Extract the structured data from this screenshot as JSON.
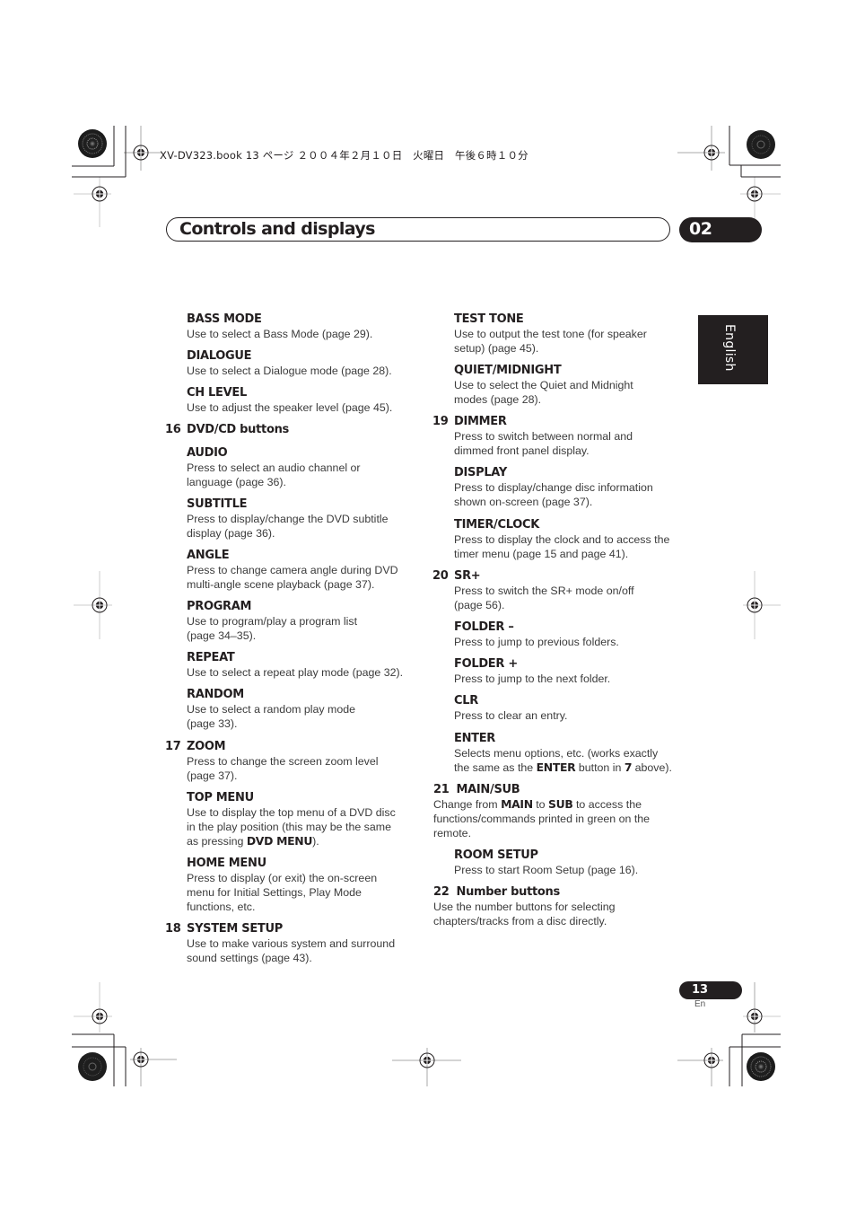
{
  "print_info": "XV-DV323.book  13 ページ  ２００４年２月１０日　火曜日　午後６時１０分",
  "header": {
    "title": "Controls and displays",
    "chapter": "02"
  },
  "language_tab": "English",
  "left_column": [
    {
      "num": "",
      "title": "BASS MODE",
      "desc": [
        "Use to select a Bass Mode (page 29)."
      ]
    },
    {
      "num": "",
      "title": "DIALOGUE",
      "desc": [
        "Use to select a Dialogue mode (page 28)."
      ]
    },
    {
      "num": "",
      "title": "CH LEVEL",
      "desc": [
        "Use to adjust the speaker level (page 45)."
      ]
    },
    {
      "num": "16",
      "title": "DVD/CD buttons",
      "desc": []
    },
    {
      "num": "",
      "title": "AUDIO",
      "desc": [
        "Press to select an audio channel or",
        "language (page 36)."
      ]
    },
    {
      "num": "",
      "title": "SUBTITLE",
      "desc": [
        "Press to display/change the DVD subtitle",
        "display (page 36)."
      ]
    },
    {
      "num": "",
      "title": "ANGLE",
      "desc": [
        "Press to change camera angle during DVD",
        "multi-angle scene playback (page 37)."
      ]
    },
    {
      "num": "",
      "title": "PROGRAM",
      "desc": [
        "Use to program/play a program list",
        "(page 34–35)."
      ]
    },
    {
      "num": "",
      "title": "REPEAT",
      "desc": [
        "Use to select a repeat play mode (page 32)."
      ]
    },
    {
      "num": "",
      "title": "RANDOM",
      "desc": [
        "Use to select a random play mode",
        "(page 33)."
      ]
    },
    {
      "num": "17",
      "title": "ZOOM",
      "desc": [
        "Press to change the screen zoom level",
        "(page 37)."
      ]
    },
    {
      "num": "",
      "title": "TOP MENU",
      "desc": [
        "Use to display the top menu of a DVD disc",
        "in the play position (this may be the same"
      ],
      "desc_tail": {
        "pre": "as pressing ",
        "bold": "DVD MENU",
        "post": ")."
      }
    },
    {
      "num": "",
      "title": "HOME MENU",
      "desc": [
        "Press to display (or exit) the on-screen",
        "menu for Initial Settings, Play Mode",
        "functions, etc."
      ]
    },
    {
      "num": "18",
      "title": "SYSTEM SETUP",
      "desc": [
        "Use to make various system and surround",
        "sound settings (page 43)."
      ]
    }
  ],
  "right_column": [
    {
      "num": "",
      "title": "TEST TONE",
      "desc": [
        "Use to output the test tone (for speaker",
        "setup) (page 45)."
      ]
    },
    {
      "num": "",
      "title": "QUIET/MIDNIGHT",
      "desc": [
        "Use to select the Quiet and Midnight",
        "modes (page 28)."
      ]
    },
    {
      "num": "19",
      "title": "DIMMER",
      "desc": [
        "Press to switch between normal and",
        "dimmed front panel display."
      ]
    },
    {
      "num": "",
      "title": "DISPLAY",
      "desc": [
        "Press to display/change disc information",
        "shown on-screen (page 37)."
      ]
    },
    {
      "num": "",
      "title": "TIMER/CLOCK",
      "desc": [
        "Press to display the clock and to access the",
        "timer menu (page 15 and page 41)."
      ]
    },
    {
      "num": "20",
      "title": "SR+",
      "desc": [
        "Press to switch the SR+ mode on/off",
        "(page 56)."
      ]
    },
    {
      "num": "",
      "title": "FOLDER –",
      "desc": [
        "Press to jump to previous folders."
      ]
    },
    {
      "num": "",
      "title": "FOLDER +",
      "desc": [
        "Press to jump to the next folder."
      ]
    },
    {
      "num": "",
      "title": "CLR",
      "desc": [
        "Press to clear an entry."
      ]
    },
    {
      "num": "",
      "title": "ENTER",
      "desc": [
        "Selects menu options, etc. (works exactly"
      ],
      "desc_tail": {
        "pre": "the same as the ",
        "bold": "ENTER",
        "mid": " button in ",
        "bold2": "7",
        "post": " above)."
      }
    },
    {
      "num": "21",
      "title": "MAIN/SUB",
      "outdent": true,
      "desc_rich": [
        {
          "pre": "Change from ",
          "bold": "MAIN",
          "mid": " to ",
          "bold2": "SUB",
          "post": " to access the"
        }
      ],
      "desc": [
        "functions/commands printed in green on the",
        "remote."
      ]
    },
    {
      "num": "",
      "title": "ROOM SETUP",
      "desc": [
        "Press to start Room Setup (page 16)."
      ]
    },
    {
      "num": "22",
      "title": "Number buttons",
      "outdent": true,
      "desc": [
        "Use the number buttons for selecting",
        "chapters/tracks from a disc directly."
      ]
    }
  ],
  "footer": {
    "page_number": "13",
    "page_lang": "En"
  }
}
